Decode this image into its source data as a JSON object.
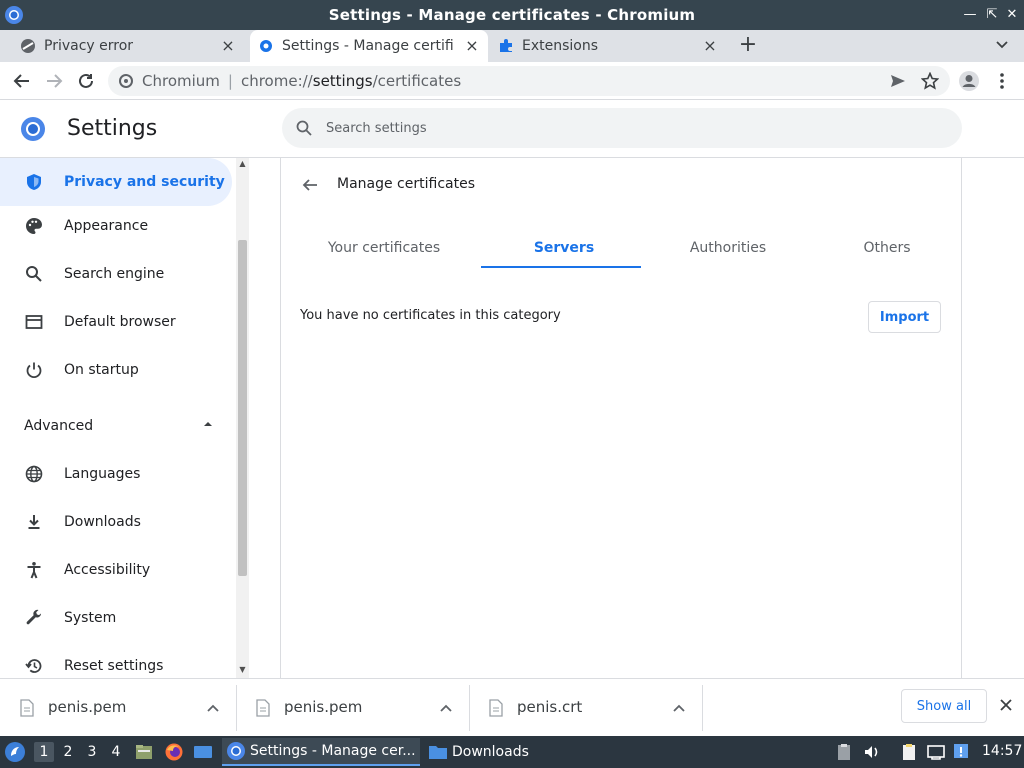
{
  "window": {
    "title": "Settings - Manage certificates - Chromium"
  },
  "tabs": [
    {
      "label": "Privacy error",
      "icon": "warning-icon"
    },
    {
      "label": "Settings - Manage certifica",
      "icon": "gear-icon",
      "active": true
    },
    {
      "label": "Extensions",
      "icon": "puzzle-icon"
    }
  ],
  "toolbar": {
    "site_name": "Chromium",
    "url_scheme": "chrome://",
    "url_host": "settings",
    "url_path": "/certificates"
  },
  "header": {
    "title": "Settings",
    "search_placeholder": "Search settings"
  },
  "sidebar": {
    "items": [
      {
        "label": "Privacy and security",
        "icon": "shield-icon",
        "active": true
      },
      {
        "label": "Appearance",
        "icon": "palette-icon"
      },
      {
        "label": "Search engine",
        "icon": "search-icon"
      },
      {
        "label": "Default browser",
        "icon": "browser-icon"
      },
      {
        "label": "On startup",
        "icon": "power-icon"
      }
    ],
    "advanced_label": "Advanced",
    "advanced_items": [
      {
        "label": "Languages",
        "icon": "globe-icon"
      },
      {
        "label": "Downloads",
        "icon": "download-icon"
      },
      {
        "label": "Accessibility",
        "icon": "accessibility-icon"
      },
      {
        "label": "System",
        "icon": "wrench-icon"
      },
      {
        "label": "Reset settings",
        "icon": "reset-icon"
      }
    ]
  },
  "main": {
    "heading": "Manage certificates",
    "tabs": [
      {
        "label": "Your certificates"
      },
      {
        "label": "Servers",
        "active": true
      },
      {
        "label": "Authorities"
      },
      {
        "label": "Others"
      }
    ],
    "empty_message": "You have no certificates in this category",
    "import_label": "Import"
  },
  "downloads": {
    "items": [
      {
        "name": "penis.pem"
      },
      {
        "name": "penis.pem"
      },
      {
        "name": "penis.crt"
      }
    ],
    "show_all_label": "Show all"
  },
  "taskbar": {
    "workspaces": [
      "1",
      "2",
      "3",
      "4"
    ],
    "tasks": [
      {
        "label": "Settings - Manage cer...",
        "active": true
      },
      {
        "label": "Downloads"
      }
    ],
    "clock": "14:57"
  },
  "colors": {
    "accent": "#1a73e8",
    "titlebar": "#36454f",
    "taskbar": "#2b3640"
  }
}
